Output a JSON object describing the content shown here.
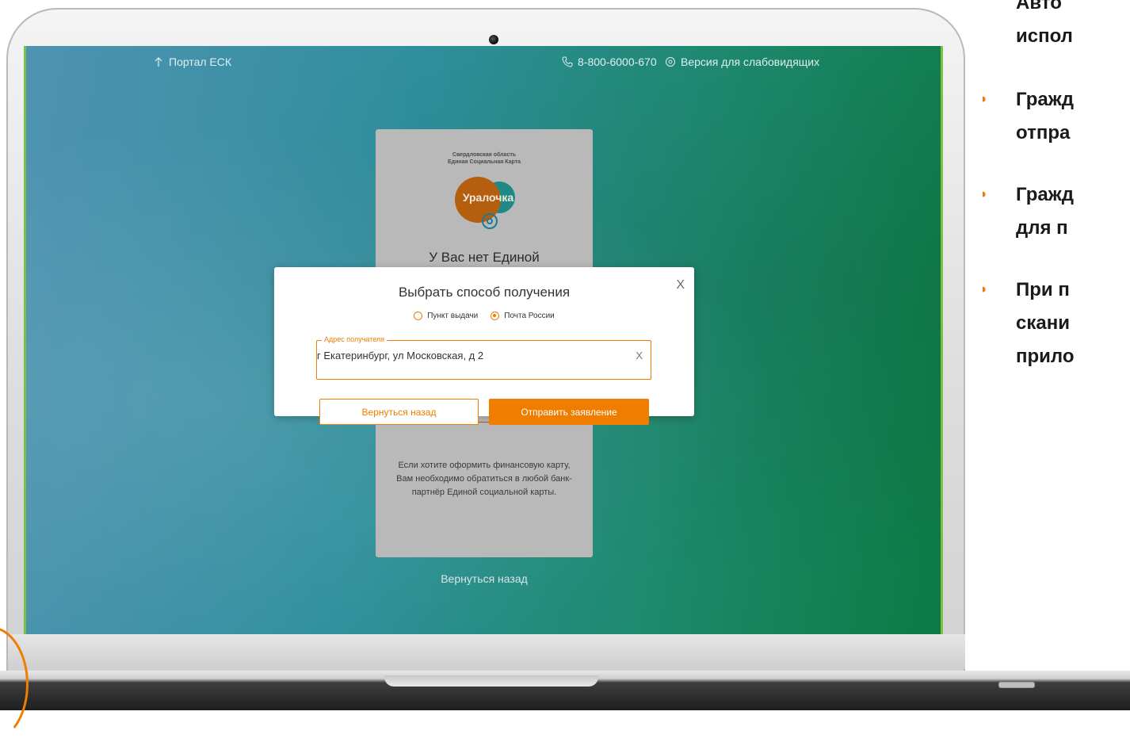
{
  "topbar": {
    "portal_label": "Портал ЕСК",
    "phone": "8-800-6000-670",
    "vision_label": "Версия для слабовидящих"
  },
  "card": {
    "region_line1": "Свердловская область",
    "region_line2": "Единая Социальная Карта",
    "logo_text": "Уралочка",
    "heading": "У Вас нет Единой",
    "note": "Если хотите оформить финансовую карту, Вам необходимо обратиться в любой банк-партнёр Единой социальной карты.",
    "back_link": "Вернуться назад"
  },
  "modal": {
    "title": "Выбрать способ получения",
    "close_label": "X",
    "options": [
      {
        "label": "Пункт выдачи",
        "checked": false
      },
      {
        "label": "Почта России",
        "checked": true
      }
    ],
    "address_label": "Адрес получателя",
    "address_value": "г Екатеринбург, ул Московская, д 2",
    "address_clear": "X",
    "back_button": "Вернуться назад",
    "submit_button": "Отправить заявление"
  },
  "slide": {
    "lines": [
      {
        "text": "Авто",
        "bullet": false
      },
      {
        "text": "испол",
        "bullet": false
      },
      {
        "text": "Гражд",
        "bullet": true
      },
      {
        "text": "отпра",
        "bullet": false
      },
      {
        "text": "Гражд",
        "bullet": true
      },
      {
        "text": "для п",
        "bullet": false
      },
      {
        "text": "При п",
        "bullet": true
      },
      {
        "text": "скани",
        "bullet": false
      },
      {
        "text": "прило",
        "bullet": false
      }
    ]
  },
  "colors": {
    "accent": "#f07d00",
    "screen_green": "#0d7a44",
    "screen_blue": "#4f93b3"
  }
}
